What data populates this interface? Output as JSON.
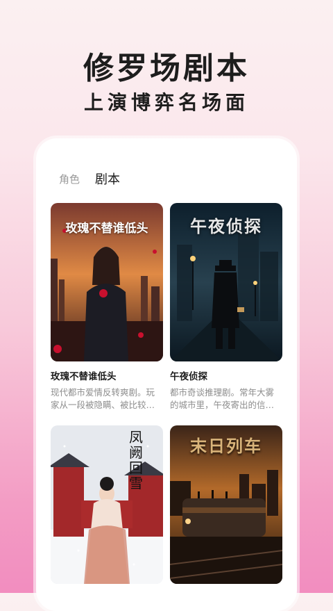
{
  "header": {
    "title": "修罗场剧本",
    "subtitle": "上演博弈名场面"
  },
  "tabs": [
    {
      "label": "角色"
    },
    {
      "label": "剧本"
    }
  ],
  "cards": [
    {
      "poster_text": "玫瑰不替谁低头",
      "title": "玫瑰不替谁低头",
      "desc": "现代都市爱情反转爽剧。玩家从一段被隐瞒、被比较…"
    },
    {
      "poster_text": "午夜侦探",
      "title": "午夜侦探",
      "desc": "都市奇谈推理剧。常年大雾的城市里，午夜寄出的信…"
    },
    {
      "poster_text": "凤阙回雪"
    },
    {
      "poster_text": "末日列车"
    }
  ],
  "colors": {
    "background_top": "#fbf0f1",
    "background_bottom": "#f28dbf",
    "card_bg": "#ffffff"
  }
}
